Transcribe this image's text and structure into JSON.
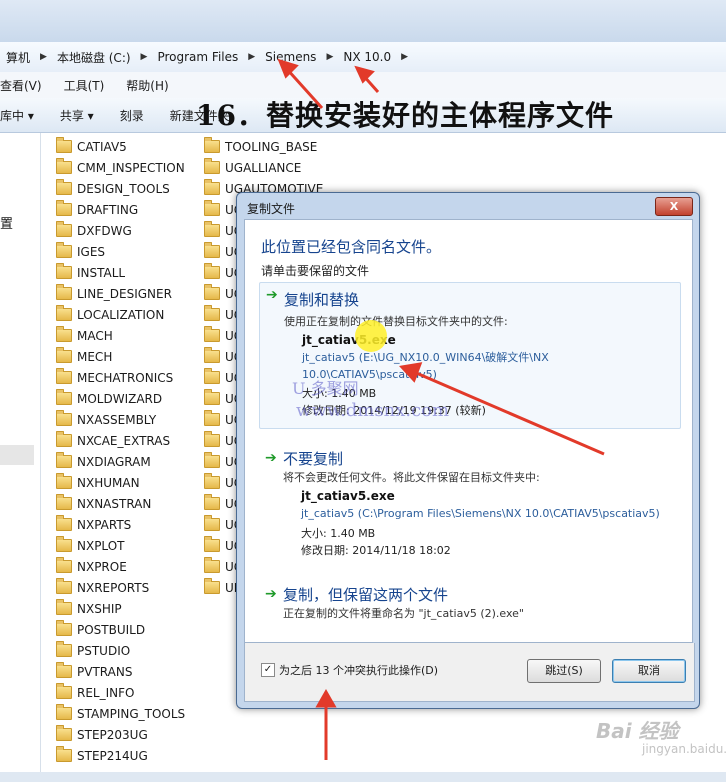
{
  "address": {
    "segments": [
      "算机",
      "本地磁盘 (C:)",
      "Program Files",
      "Siemens",
      "NX 10.0"
    ]
  },
  "menu": [
    "查看(V)",
    "工具(T)",
    "帮助(H)"
  ],
  "toolbar": [
    "库中 ▾",
    "共享 ▾",
    "刻录",
    "新建文件夹"
  ],
  "headline": "16．替换安装好的主体程序文件",
  "navpane": {
    "label": "置"
  },
  "folders_col1": [
    "CATIAV5",
    "CMM_INSPECTION",
    "DESIGN_TOOLS",
    "DRAFTING",
    "DXFDWG",
    "IGES",
    "INSTALL",
    "LINE_DESIGNER",
    "LOCALIZATION",
    "MACH",
    "MECH",
    "MECHATRONICS",
    "MOLDWIZARD",
    "NXASSEMBLY",
    "NXCAE_EXTRAS",
    "NXDIAGRAM",
    "NXHUMAN",
    "NXNASTRAN",
    "NXPARTS",
    "NXPLOT",
    "NXPROE",
    "NXREPORTS",
    "NXSHIP",
    "POSTBUILD",
    "PSTUDIO",
    "PVTRANS",
    "REL_INFO",
    "STAMPING_TOOLS",
    "STEP203UG",
    "STEP214UG"
  ],
  "folders_col2": [
    "TOOLING_BASE",
    "UGALLIANCE",
    "UGAUTOMOTIVE",
    "UG",
    "UG",
    "UG",
    "UG",
    "UG",
    "UG",
    "UG",
    "UG",
    "UG",
    "UG",
    "UG",
    "UG",
    "UG",
    "UG",
    "UG",
    "UG",
    "UG",
    "UG",
    "UN"
  ],
  "dialog": {
    "title": "复制文件",
    "close": "X",
    "heading": "此位置已经包含同名文件。",
    "subheading": "请单击要保留的文件",
    "option_replace": {
      "title": "复制和替换",
      "desc": "使用正在复制的文件替换目标文件夹中的文件:",
      "filename": "jt_catiav5.exe",
      "path": "jt_catiav5 (E:\\UG_NX10.0_WIN64\\破解文件\\NX 10.0\\CATIAV5\\pscatiav5)",
      "size": "大小: 1.40 MB",
      "date": "修改日期: 2014/12/19 19:37 (较新)"
    },
    "option_keep": {
      "title": "不要复制",
      "desc": "将不会更改任何文件。将此文件保留在目标文件夹中:",
      "filename": "jt_catiav5.exe",
      "path": "jt_catiav5 (C:\\Program Files\\Siemens\\NX 10.0\\CATIAV5\\pscatiav5)",
      "size": "大小: 1.40 MB",
      "date": "修改日期: 2014/11/18 18:02"
    },
    "option_both": {
      "title": "复制，但保留这两个文件",
      "desc": "正在复制的文件将重命名为 \"jt_catiav5 (2).exe\""
    },
    "checkbox_label": "为之后 13 个冲突执行此操作(D)",
    "checkbox_checked": true,
    "skip_button": "跳过(S)",
    "cancel_button": "取消"
  },
  "watermark": {
    "line1": "U 多聚网",
    "line2": "www.dmsnx.com"
  },
  "baidu": {
    "logo": "Bai 经验",
    "url": "jingyan.baidu.com"
  },
  "colors": {
    "annotation_arrow": "#e23a2a",
    "dialog_link": "#16448e",
    "option_arrow": "#1f9a2a"
  }
}
